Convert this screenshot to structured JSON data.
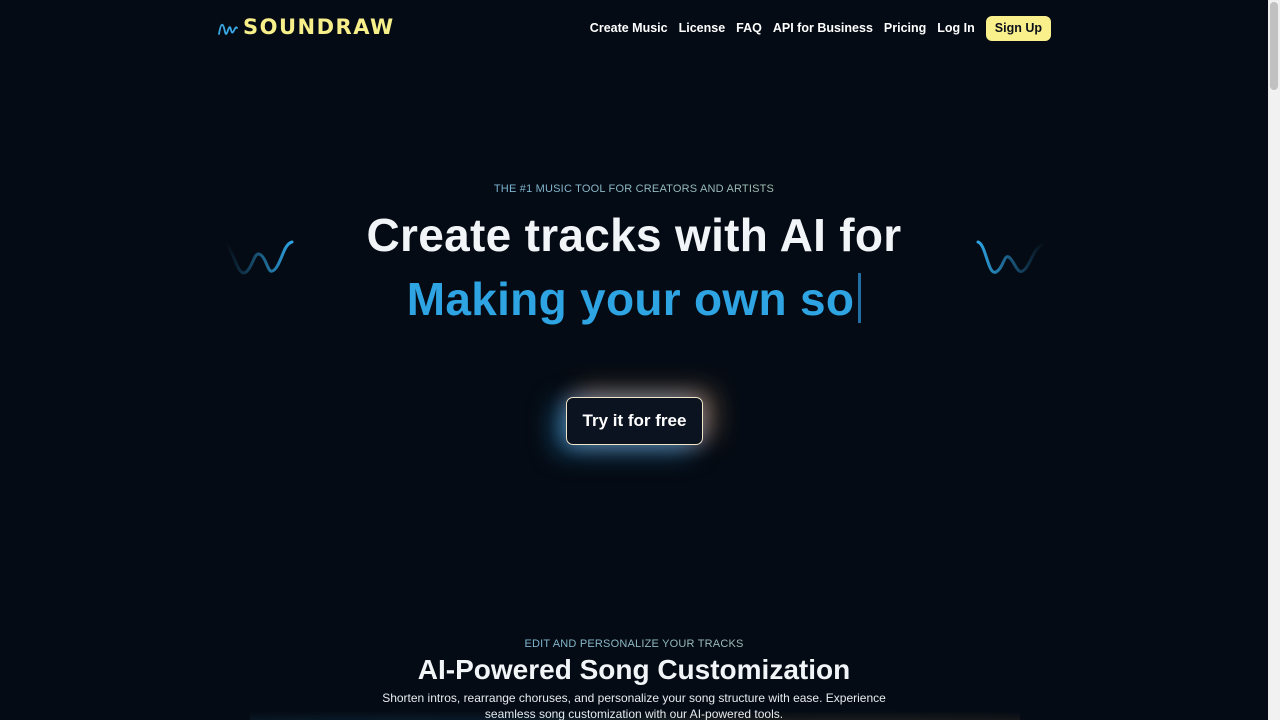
{
  "header": {
    "logo_text": "SOUNDRAW",
    "nav": [
      {
        "label": "Create Music"
      },
      {
        "label": "License"
      },
      {
        "label": "FAQ"
      },
      {
        "label": "API for Business"
      },
      {
        "label": "Pricing"
      },
      {
        "label": "Log In"
      }
    ],
    "signup_label": "Sign Up"
  },
  "hero": {
    "eyebrow": "THE #1 MUSIC TOOL FOR CREATORS AND ARTISTS",
    "title": "Create tracks with AI for",
    "typed_text": "Making your own so",
    "cta_label": "Try it for free"
  },
  "section": {
    "eyebrow": "EDIT AND PERSONALIZE YOUR TRACKS",
    "title": "AI-Powered Song Customization",
    "description": "Shorten intros, rearrange choruses, and personalize your song structure with ease. Experience seamless song customization with our AI-powered tools."
  },
  "colors": {
    "background": "#050b14",
    "brand_yellow": "#f7ef8a",
    "accent_blue": "#2ea4e3"
  },
  "icons": {
    "logo": "wave-logo-icon",
    "decor": "sound-wave-icon"
  }
}
